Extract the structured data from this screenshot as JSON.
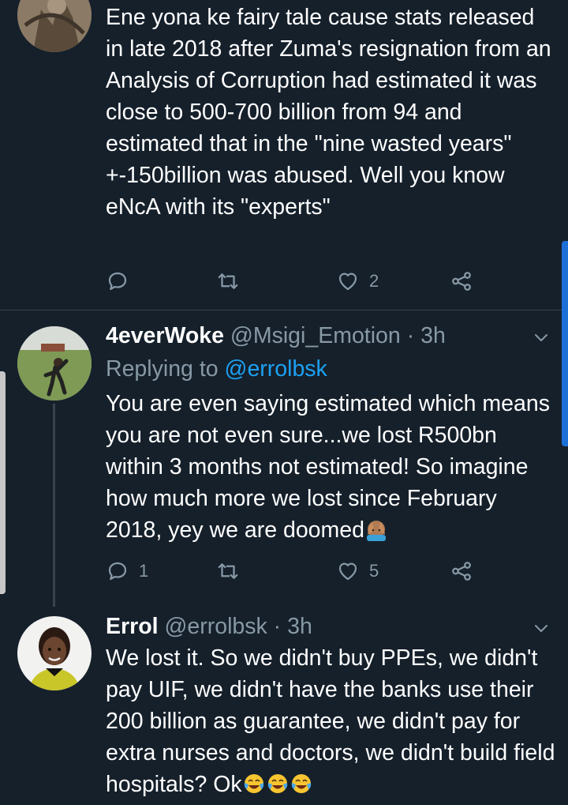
{
  "tweets": [
    {
      "body": "Ene yona ke fairy tale cause stats released in late 2018 after Zuma's resignation from an Analysis of Corruption had estimated it was close to 500-700 billion from 94 and estimated that in the \"nine wasted years\" +-150billion was abused. Well you know eNcA with its \"experts\"",
      "reply_count": "",
      "like_count": "2"
    },
    {
      "name": "4everWoke",
      "handle": "@Msigi_Emotion",
      "separator": "·",
      "time": "3h",
      "replying_prefix": "Replying to ",
      "replying_to": "@errolbsk",
      "body": "You are even saying estimated which means you are not even sure...we lost R500bn within 3 months not estimated! So imagine how much more we lost since February 2018, yey we are doomed",
      "reply_count": "1",
      "like_count": "5"
    },
    {
      "name": "Errol",
      "handle": "@errolbsk",
      "separator": "·",
      "time": "3h",
      "body": "We lost it. So we didn't buy PPEs, we didn't pay UIF, we didn't have the banks use their 200 billion as guarantee, we didn't pay for extra nurses and doctors, we didn't build field hospitals? Ok"
    }
  ],
  "colors": {
    "background": "#15202b",
    "text": "#ffffff",
    "muted": "#8899a6",
    "link": "#1da1f2",
    "divider": "#38444d"
  },
  "icons": [
    "reply-icon",
    "retweet-icon",
    "like-icon",
    "share-icon",
    "chevron-down-icon",
    "facepalm-emoji",
    "laughing-crying-emoji"
  ]
}
